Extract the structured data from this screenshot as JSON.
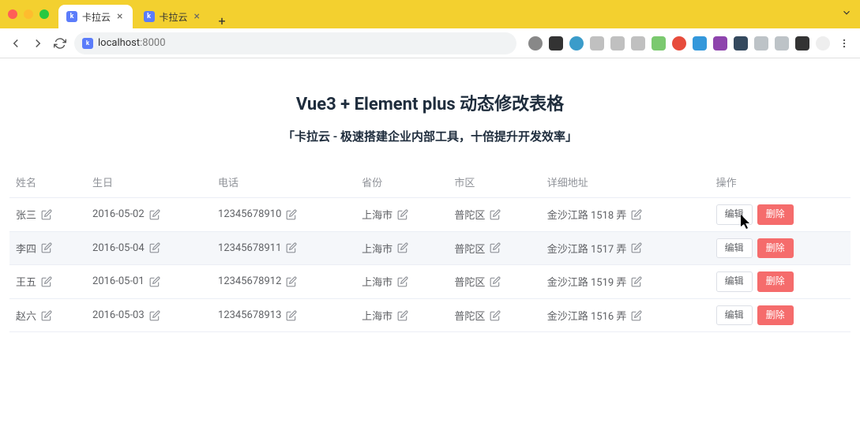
{
  "browser": {
    "tabs": [
      {
        "label": "卡拉云",
        "active": true
      },
      {
        "label": "卡拉云",
        "active": false
      }
    ],
    "url_host": "localhost",
    "url_port": ":8000",
    "ext_colors": [
      "#a0a0a0",
      "#333",
      "#3b9cca",
      "#c0c0c0",
      "#a0a0a0",
      "#a0a0a0",
      "#7bc96f",
      "#e74c3c",
      "#3498db",
      "#8e44ad",
      "#34495e",
      "#bdc3c7",
      "#bdc3c7",
      "#bdc3c7",
      "#333"
    ]
  },
  "page": {
    "title": "Vue3 + Element plus 动态修改表格",
    "subtitle": "「卡拉云 - 极速搭建企业内部工具，十倍提升开发效率」"
  },
  "table": {
    "headers": [
      "姓名",
      "生日",
      "电话",
      "省份",
      "市区",
      "详细地址",
      "操作"
    ],
    "edit_label": "编辑",
    "delete_label": "删除",
    "rows": [
      {
        "name": "张三",
        "birthday": "2016-05-02",
        "phone": "12345678910",
        "province": "上海市",
        "district": "普陀区",
        "address": "金沙江路 1518 弄"
      },
      {
        "name": "李四",
        "birthday": "2016-05-04",
        "phone": "12345678911",
        "province": "上海市",
        "district": "普陀区",
        "address": "金沙江路 1517 弄"
      },
      {
        "name": "王五",
        "birthday": "2016-05-01",
        "phone": "12345678912",
        "province": "上海市",
        "district": "普陀区",
        "address": "金沙江路 1519 弄"
      },
      {
        "name": "赵六",
        "birthday": "2016-05-03",
        "phone": "12345678913",
        "province": "上海市",
        "district": "普陀区",
        "address": "金沙江路 1516 弄"
      }
    ]
  }
}
